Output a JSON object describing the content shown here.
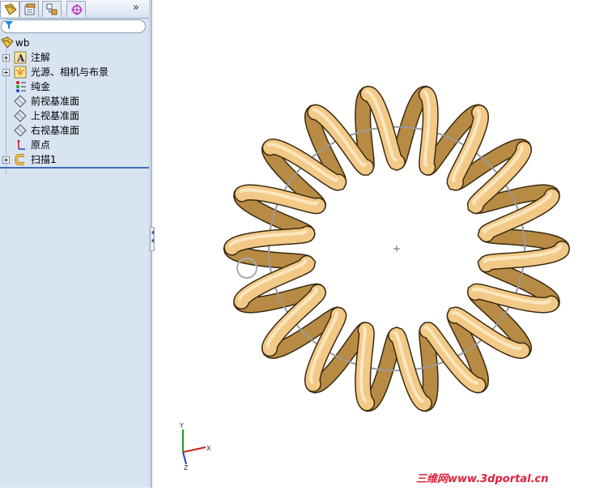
{
  "feature_manager": {
    "tabs": [
      {
        "name": "featuremanager-tab",
        "active": true
      },
      {
        "name": "propertymanager-tab",
        "active": false
      },
      {
        "name": "configurationmanager-tab",
        "active": false
      },
      {
        "name": "dimxpert-tab",
        "active": false
      }
    ],
    "more_label": "»",
    "filter_placeholder": "",
    "root": {
      "label": "wb"
    },
    "items": [
      {
        "label": "注解",
        "icon": "annotations-icon",
        "expandable": true
      },
      {
        "label": "光源、相机与布景",
        "icon": "lights-cameras-scene-icon",
        "expandable": true
      },
      {
        "label": "纯金",
        "icon": "material-icon",
        "expandable": false
      },
      {
        "label": "前视基准面",
        "icon": "plane-icon",
        "expandable": false
      },
      {
        "label": "上视基准面",
        "icon": "plane-icon",
        "expandable": false
      },
      {
        "label": "右视基准面",
        "icon": "plane-icon",
        "expandable": false
      },
      {
        "label": "原点",
        "icon": "origin-icon",
        "expandable": false
      },
      {
        "label": "扫描1",
        "icon": "sweep-feature-icon",
        "expandable": true
      }
    ]
  },
  "viewport": {
    "model": "helical coil torus",
    "coil_color": "#f2c987",
    "coil_shadow": "#b88b45",
    "path_circle_color": "#9a9a9a",
    "triad": {
      "x_label": "X",
      "y_label": "Y",
      "z_label": "Z"
    }
  },
  "watermark": "三维网www.3dportal.cn"
}
